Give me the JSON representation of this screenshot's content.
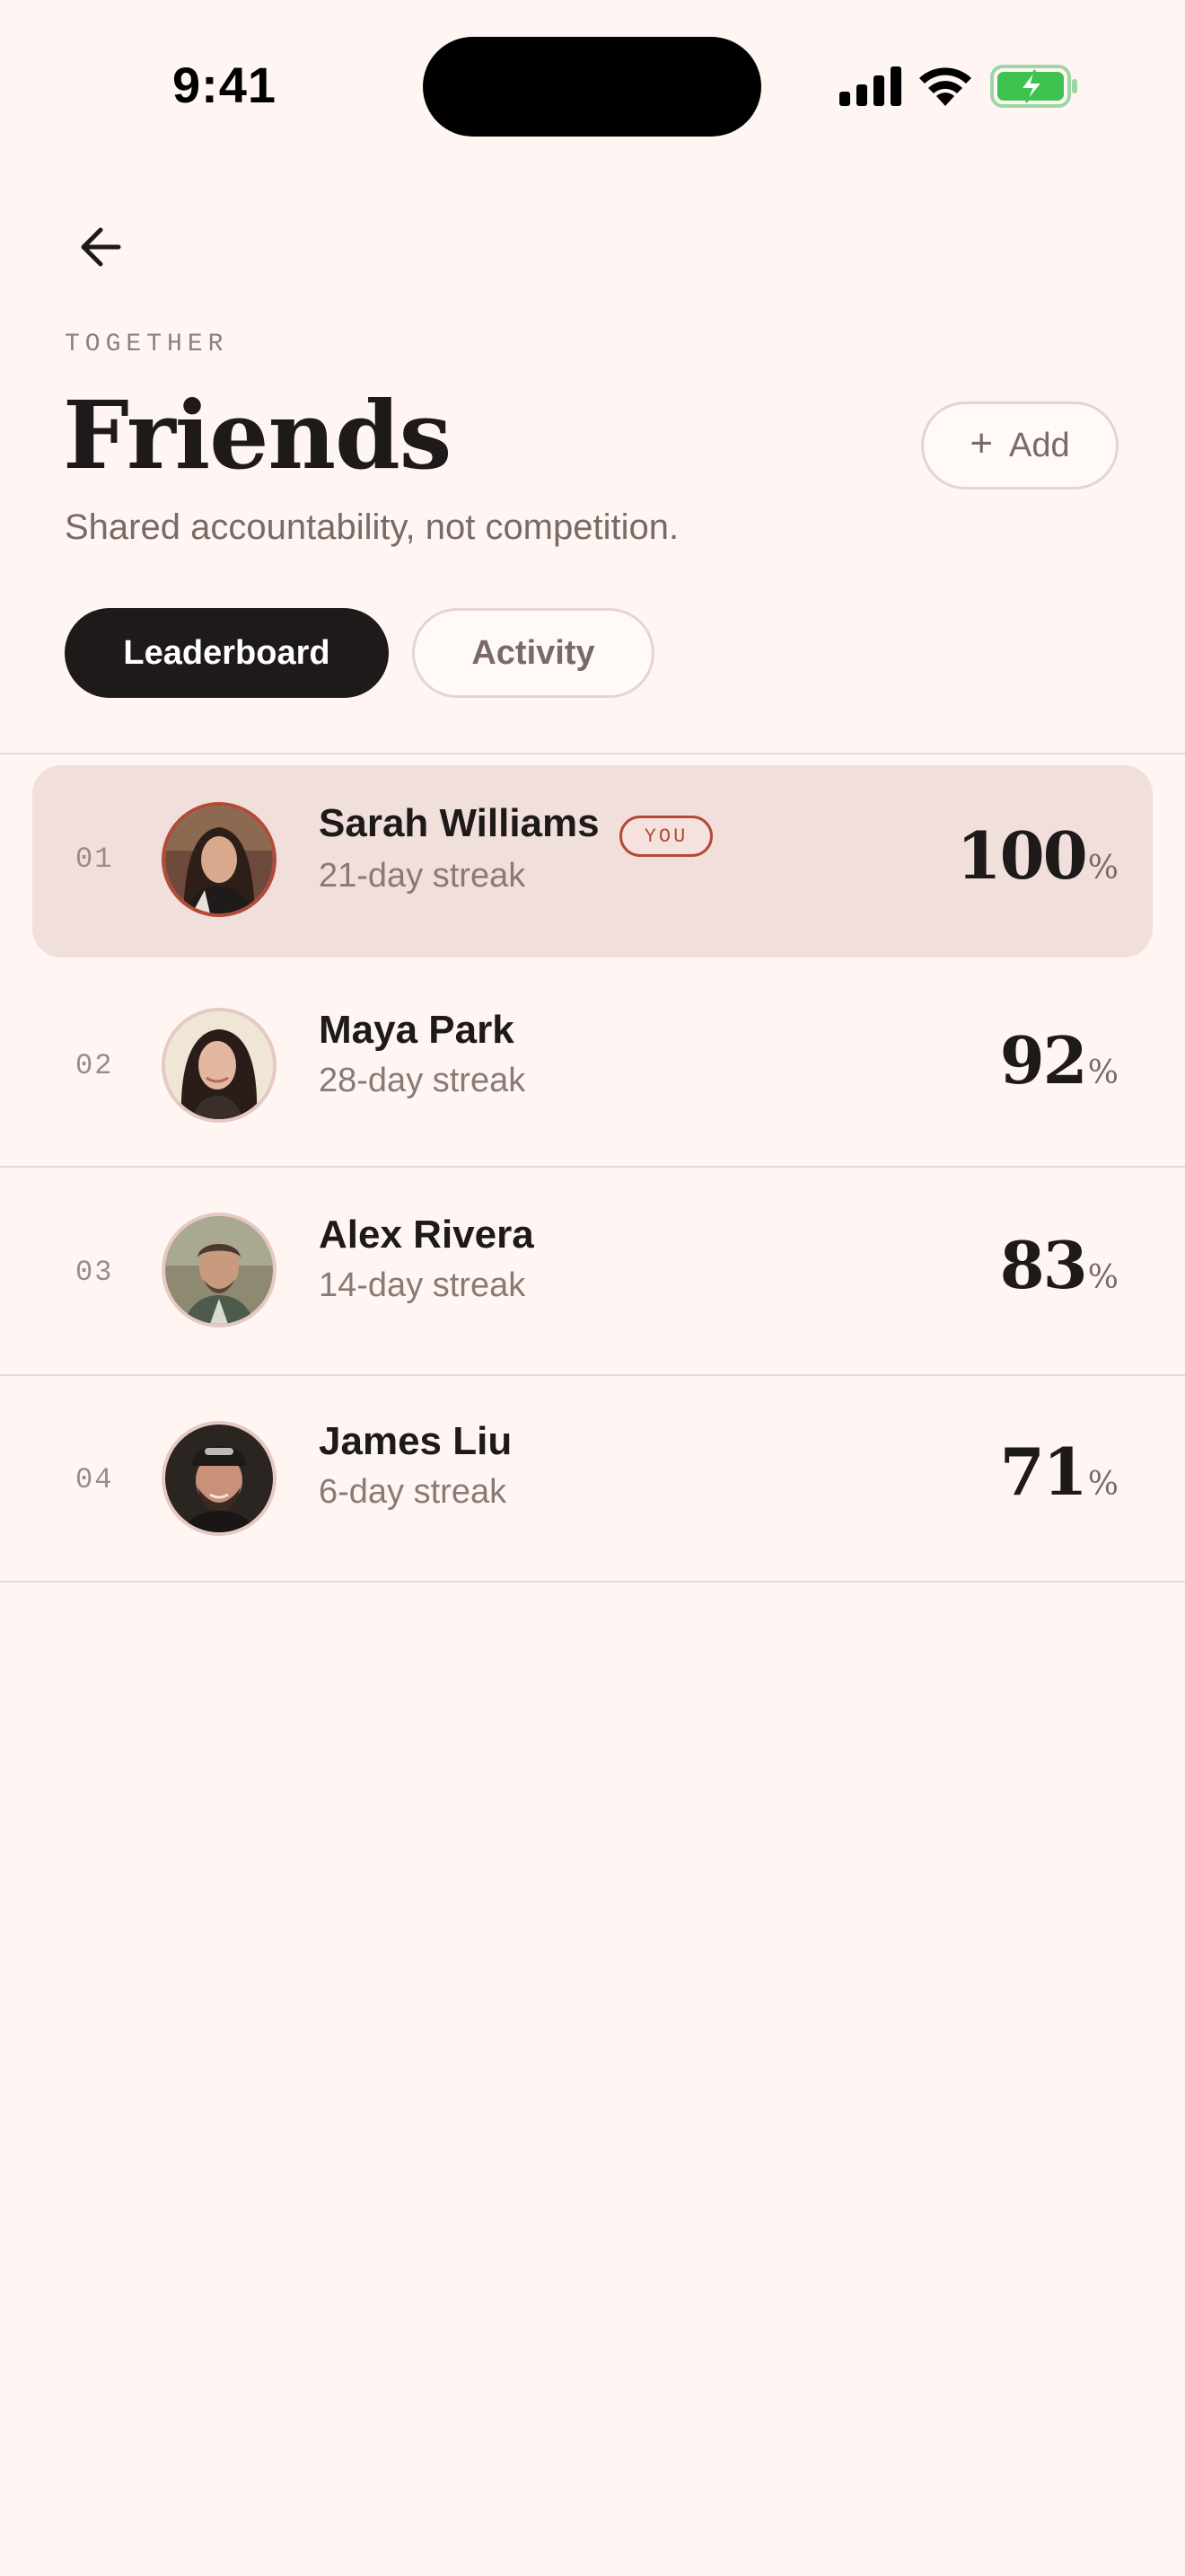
{
  "status_bar": {
    "time": "9:41"
  },
  "header": {
    "eyebrow": "TOGETHER",
    "title": "Friends",
    "subtitle": "Shared accountability, not competition.",
    "add_label": "Add"
  },
  "tabs": [
    {
      "label": "Leaderboard",
      "active": true
    },
    {
      "label": "Activity",
      "active": false
    }
  ],
  "leaderboard": [
    {
      "rank": "01",
      "name": "Sarah Williams",
      "badge": "YOU",
      "streak": "21-day streak",
      "score": "100",
      "unit": "%"
    },
    {
      "rank": "02",
      "name": "Maya Park",
      "streak": "28-day streak",
      "score": "92",
      "unit": "%"
    },
    {
      "rank": "03",
      "name": "Alex Rivera",
      "streak": "14-day streak",
      "score": "83",
      "unit": "%"
    },
    {
      "rank": "04",
      "name": "James Liu",
      "streak": "6-day streak",
      "score": "71",
      "unit": "%"
    }
  ],
  "colors": {
    "background": "#FFF6F4",
    "highlight_row": "#F1DFDC",
    "accent": "#B24A36",
    "battery": "#3DC24F"
  }
}
